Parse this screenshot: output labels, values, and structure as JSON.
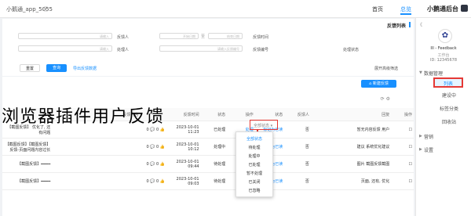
{
  "topbar": {
    "brand": "小鹅通后台",
    "nav_home": "首页",
    "nav_current": "总览",
    "user": "小鹅通_app_5055",
    "bell": "ⓘ"
  },
  "sidebar": {
    "collapse": "《",
    "avatar": "✿",
    "name": "III - Feedback",
    "sub": "工作台",
    "id": "ID: 12345678",
    "groups": [
      {
        "label": "数据管理",
        "arrow": "▼"
      },
      {
        "label": "营销",
        "arrow": "▶"
      },
      {
        "label": "设置",
        "arrow": "▶"
      }
    ],
    "items": [
      {
        "label": "列表"
      },
      {
        "label": "建设中"
      },
      {
        "label": "标签分类"
      },
      {
        "label": "回收站"
      }
    ]
  },
  "filter": {
    "title": "反馈列表",
    "fields": [
      {
        "label": "反馈时间",
        "placeholder": "开始日期"
      },
      {
        "label": "至",
        "placeholder": "结束日期"
      },
      {
        "label": "反馈人",
        "placeholder": "请输入"
      },
      {
        "label": "反馈编号",
        "placeholder": "请输入反馈编号"
      },
      {
        "label": "处理状态",
        "placeholder": "请选择"
      },
      {
        "label": "处理人",
        "placeholder": "请输入"
      }
    ],
    "search_btn": "查询",
    "reset_btn": "重置",
    "export_link": "导出反馈数据",
    "advanced": "展开高级筛选"
  },
  "list": {
    "create_btn": "⌂ 新建反馈",
    "tool_icons": "⟳  ⚙",
    "headers": [
      "",
      "反馈内容",
      "",
      "反馈时间",
      "状态",
      "处理人",
      "操作",
      "",
      "状态",
      "反馈人",
      "回复",
      "编号",
      "操作"
    ],
    "rows": [
      [
        "【截图反馈】 优化了, 还有问题",
        "0 💬 0 👍",
        "2023-10-01 11:23",
        "已处理",
        "管理员",
        "删除",
        "处理",
        "标记为已读"
      ],
      [
        "【截图反馈】【截图反馈】反馈-页面问题内容过长",
        "0 💬 0 👍",
        "2023-10-01 10:12",
        "处理中",
        "管理员",
        "删除",
        "处理",
        "标记为已读"
      ],
      [
        "【截图反馈】━━━━",
        "0 💬 0 👍",
        "2023-10-01 09:44",
        "待处理",
        "管理员",
        "删除",
        "处理",
        "标记为已读"
      ],
      [
        "【截图反馈】━━━━",
        "0 💬 0 👍",
        "2023-10-01 09:03",
        "待处理",
        "管理员",
        "删除",
        "处理",
        "标记为已读"
      ]
    ],
    "right_rows": [
      [
        "暂无内容反馈 用户",
        "否"
      ],
      [
        "建议 系统优化建议",
        "否"
      ],
      [
        "图片 截图反馈截图",
        "否"
      ],
      [
        "页面, 还有, 优化",
        "否"
      ]
    ]
  },
  "dropdown": {
    "options": [
      "全部状态",
      "待处理",
      "处理中",
      "已处理",
      "暂不处理",
      "已关闭",
      "已忽略"
    ],
    "trigger": "全部状态 ▾"
  },
  "overlay": {
    "title": "浏览器插件用户反馈"
  }
}
